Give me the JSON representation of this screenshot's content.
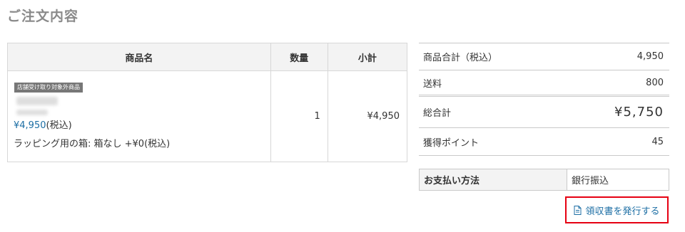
{
  "page": {
    "title": "ご注文内容"
  },
  "order_table": {
    "headers": {
      "name": "商品名",
      "quantity": "数量",
      "subtotal": "小計"
    },
    "items": [
      {
        "badge": "店舗受け取り対象外商品",
        "price": "¥4,950",
        "tax_note": "(税込)",
        "wrapping": "ラッピング用の箱: 箱なし +¥0(税込)",
        "quantity": "1",
        "subtotal": "¥4,950"
      }
    ]
  },
  "summary": {
    "rows": [
      {
        "label": "商品合計（税込）",
        "value": "4,950"
      },
      {
        "label": "送料",
        "value": "800"
      },
      {
        "label": "総合計",
        "value": "¥5,750"
      },
      {
        "label": "獲得ポイント",
        "value": "45"
      }
    ]
  },
  "payment": {
    "label": "お支払い方法",
    "value": "銀行振込"
  },
  "receipt": {
    "label": "領収書を発行する",
    "icon": "document-icon"
  },
  "colors": {
    "link": "#1c6ea4",
    "highlight_border": "#e60012",
    "title": "#8a8a8a"
  }
}
